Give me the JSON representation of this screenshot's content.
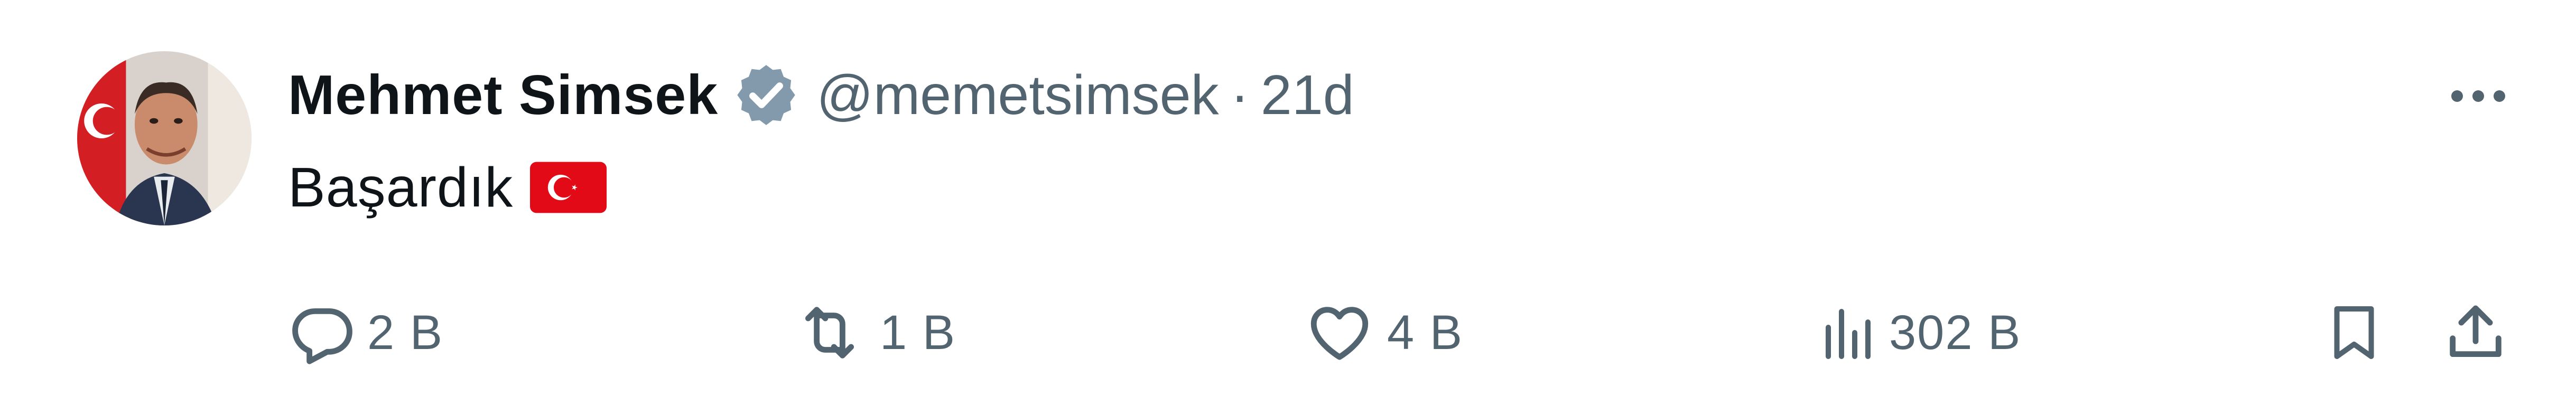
{
  "tweet": {
    "author_name": "Mehmet Simsek",
    "handle": "@memetsimsek",
    "separator": "·",
    "time": "21d",
    "text": "Başardık",
    "verified": true,
    "avatar_icon": "profile-photo",
    "flag_icon": "turkey-flag-emoji"
  },
  "actions": {
    "reply_count": "2 B",
    "retweet_count": "1 B",
    "like_count": "4 B",
    "views_count": "302 B"
  },
  "colors": {
    "text_primary": "#0f1419",
    "text_secondary": "#536471",
    "verified_badge": "#829aab",
    "flag_red": "#e30a17"
  }
}
